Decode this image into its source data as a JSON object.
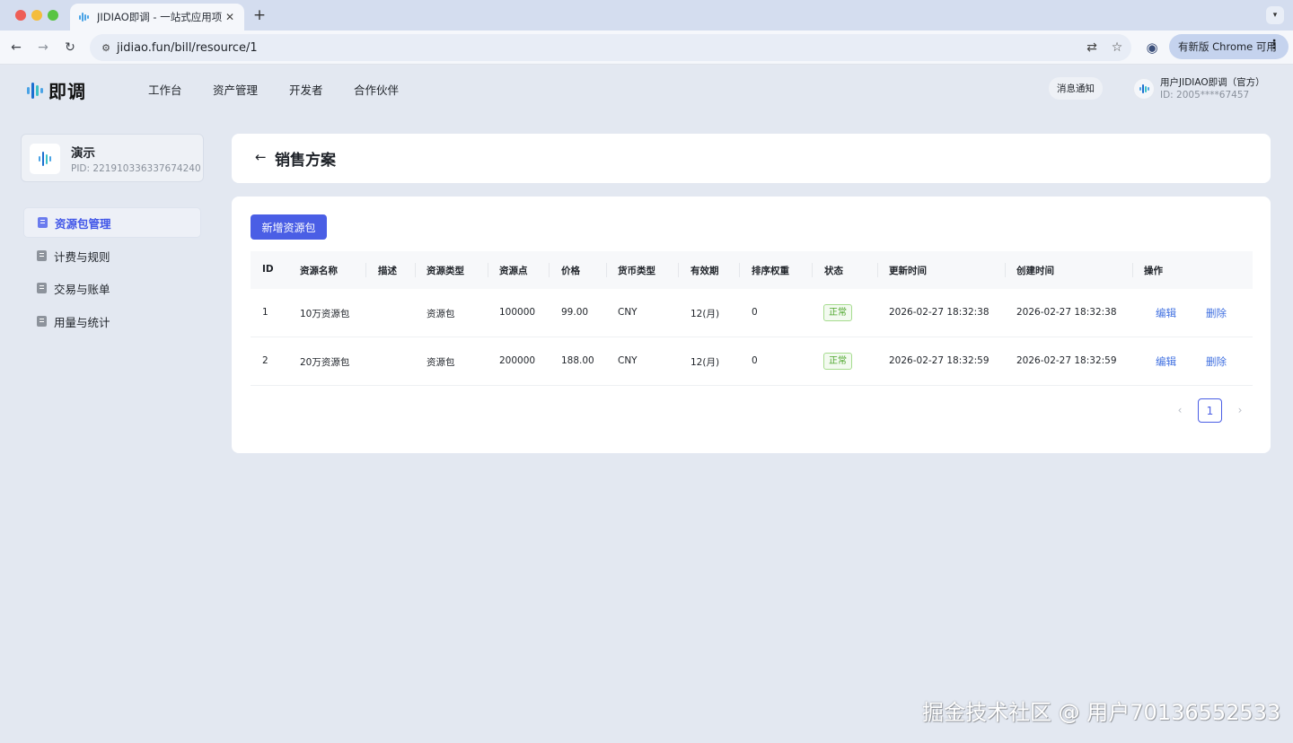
{
  "browser": {
    "tab_title": "JIDIAO即调 - 一站式应用项目管",
    "tab_close": "✕",
    "new_tab": "+",
    "url": "jidiao.fun/bill/resource/1",
    "update_label": "有新版 Chrome 可用"
  },
  "header": {
    "logo_text": "即调",
    "nav": [
      "工作台",
      "资产管理",
      "开发者",
      "合作伙伴"
    ],
    "notification_label": "消息通知",
    "user_name": "用户JIDIAO即调（官方）",
    "user_id": "ID: 2005****67457"
  },
  "project": {
    "name": "演示",
    "pid": "PID: 221910336337674240"
  },
  "sidebar": {
    "items": [
      {
        "label": "资源包管理",
        "icon": "document-icon",
        "active": true
      },
      {
        "label": "计费与规则",
        "icon": "document-icon",
        "active": false
      },
      {
        "label": "交易与账单",
        "icon": "document-icon",
        "active": false
      },
      {
        "label": "用量与统计",
        "icon": "calculator-icon",
        "active": false
      }
    ]
  },
  "page": {
    "title": "销售方案",
    "add_button": "新增资源包"
  },
  "table": {
    "columns": [
      "ID",
      "资源名称",
      "描述",
      "资源类型",
      "资源点",
      "价格",
      "货币类型",
      "有效期",
      "排序权重",
      "状态",
      "更新时间",
      "创建时间",
      "操作"
    ],
    "rows": [
      {
        "id": "1",
        "name": "10万资源包",
        "desc": "",
        "type": "资源包",
        "points": "100000",
        "price": "99.00",
        "currency": "CNY",
        "validity": "12(月)",
        "weight": "0",
        "status": "正常",
        "updated": "2026-02-27 18:32:38",
        "created": "2026-02-27 18:32:38",
        "edit": "编辑",
        "delete": "删除"
      },
      {
        "id": "2",
        "name": "20万资源包",
        "desc": "",
        "type": "资源包",
        "points": "200000",
        "price": "188.00",
        "currency": "CNY",
        "validity": "12(月)",
        "weight": "0",
        "status": "正常",
        "updated": "2026-02-27 18:32:59",
        "created": "2026-02-27 18:32:59",
        "edit": "编辑",
        "delete": "删除"
      }
    ]
  },
  "pagination": {
    "current": "1",
    "prev": "‹",
    "next": "›"
  },
  "watermark": "掘金技术社区 @ 用户70136552533",
  "colors": {
    "primary": "#4a5ee5",
    "link": "#3f6fe0",
    "status_green": "#4ca52a",
    "background": "#e3e8f1"
  }
}
